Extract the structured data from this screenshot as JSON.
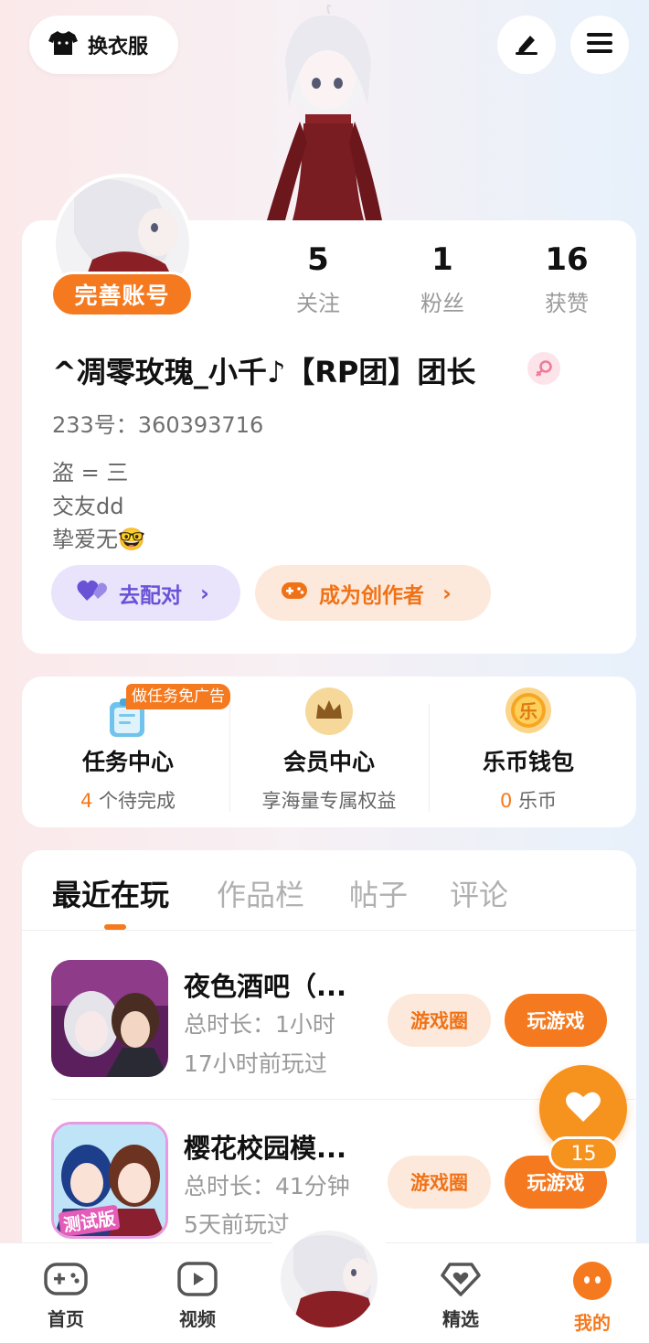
{
  "top": {
    "dress_label": "换衣服"
  },
  "profile": {
    "complete_label": "完善账号",
    "stats": [
      {
        "num": "5",
        "label": "关注"
      },
      {
        "num": "1",
        "label": "粉丝"
      },
      {
        "num": "16",
        "label": "获赞"
      }
    ],
    "username": "^凋零玫瑰_小千♪【RP团】团长",
    "uid": "233号：360393716",
    "bio": [
      "盗 = 三",
      "交友dd",
      "挚爱无🤓"
    ],
    "match_label": "去配对",
    "creator_label": "成为创作者"
  },
  "services": [
    {
      "title": "任务中心",
      "count": "4",
      "sub": " 个待完成",
      "tag": "做任务免广告"
    },
    {
      "title": "会员中心",
      "sub": "享海量专属权益"
    },
    {
      "title": "乐币钱包",
      "count": "0",
      "sub": " 乐币"
    }
  ],
  "tabs": [
    "最近在玩",
    "作品栏",
    "帖子",
    "评论"
  ],
  "games": [
    {
      "title": "夜色酒吧（...",
      "duration": "总时长：1小时",
      "last": "17小时前玩过",
      "circle": "游戏圈",
      "play": "玩游戏"
    },
    {
      "title": "樱花校园模...",
      "duration": "总时长：41分钟",
      "last": "5天前玩过",
      "circle": "游戏圈",
      "play": "玩游戏",
      "icon_text": "测试版"
    }
  ],
  "float_like": {
    "count": "15"
  },
  "nav": [
    {
      "label": "首页"
    },
    {
      "label": "视频"
    },
    {
      "label": "精选"
    },
    {
      "label": "我的"
    }
  ],
  "colors": {
    "accent": "#f5791e",
    "purple": "#6a52d6"
  }
}
